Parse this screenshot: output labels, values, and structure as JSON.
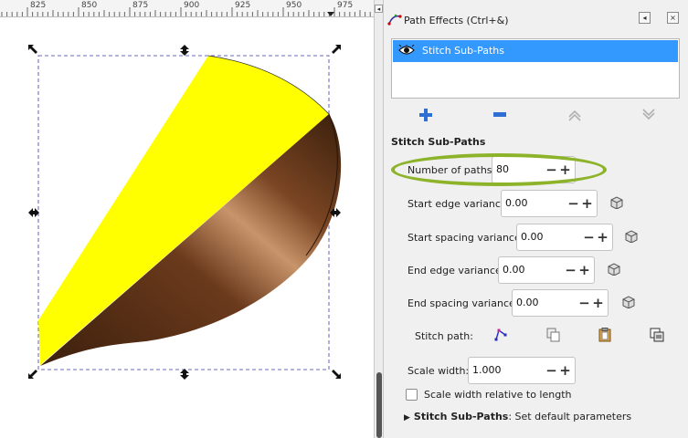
{
  "ruler": {
    "labels": [
      "825",
      "850",
      "875",
      "900",
      "925",
      "950",
      "975"
    ]
  },
  "panel": {
    "title": "Path Effects (Ctrl+&)",
    "effects": [
      {
        "label": "Stitch Sub-Paths",
        "visible_icon": "eye-icon"
      }
    ],
    "list_buttons": [
      "add-icon",
      "remove-icon",
      "move-up-icon",
      "move-down-icon"
    ],
    "section_title": "Stitch Sub-Paths",
    "params": {
      "number_of_paths": {
        "label": "Number of paths:",
        "value": "80"
      },
      "start_edge_variance": {
        "label": "Start edge variance:",
        "value": "0.00"
      },
      "start_spacing_variance": {
        "label": "Start spacing variance:",
        "value": "0.00"
      },
      "end_edge_variance": {
        "label": "End edge variance:",
        "value": "0.00"
      },
      "end_spacing_variance": {
        "label": "End spacing variance:",
        "value": "0.00"
      },
      "stitch_path": {
        "label": "Stitch path:"
      },
      "scale_width": {
        "label": "Scale width:",
        "value": "1.000"
      },
      "scale_relative": {
        "label": "Scale width relative to length",
        "checked": false
      }
    },
    "defaults": {
      "effect": "Stitch Sub-Paths",
      "text": ": Set default parameters"
    },
    "spin": {
      "minus": "−",
      "plus": "+"
    }
  },
  "colors": {
    "selection": "#3399ff",
    "highlight_ring": "#8db32a",
    "shape_yellow": "#ffff00",
    "shape_brown": "#6b3a1c"
  }
}
